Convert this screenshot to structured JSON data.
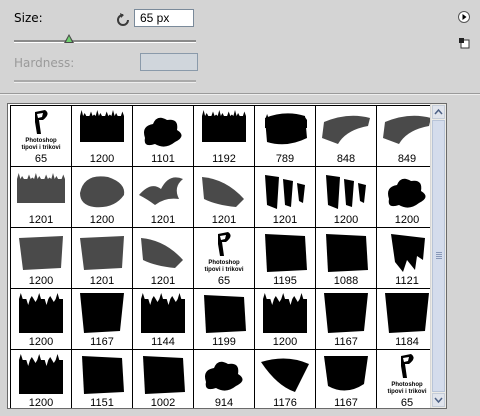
{
  "controls": {
    "size_label": "Size:",
    "size_value": "65 px",
    "size_slider_fraction": 0.3,
    "hardness_label": "Hardness:",
    "hardness_value": ""
  },
  "icons": {
    "reset": "reset-icon",
    "flyout": "flyout-menu-icon",
    "new_preset": "new-preset-icon"
  },
  "logo": {
    "line1": "Photoshop",
    "line2": "tipovi i trikovi"
  },
  "brushes": [
    {
      "n": "65",
      "kind": "logo"
    },
    {
      "n": "1200",
      "kind": "grass"
    },
    {
      "n": "1101",
      "kind": "splat"
    },
    {
      "n": "1192",
      "kind": "grass"
    },
    {
      "n": "789",
      "kind": "blob"
    },
    {
      "n": "848",
      "kind": "wedge"
    },
    {
      "n": "849",
      "kind": "wedge"
    },
    {
      "n": "1201",
      "kind": "grass-grey"
    },
    {
      "n": "1200",
      "kind": "oval-grey"
    },
    {
      "n": "1201",
      "kind": "bird-grey"
    },
    {
      "n": "1201",
      "kind": "fan-grey"
    },
    {
      "n": "1201",
      "kind": "streaks"
    },
    {
      "n": "1200",
      "kind": "streaks"
    },
    {
      "n": "1200",
      "kind": "splat"
    },
    {
      "n": "1200",
      "kind": "rect-grey"
    },
    {
      "n": "1201",
      "kind": "rect-grey"
    },
    {
      "n": "1201",
      "kind": "fan-grey"
    },
    {
      "n": "65",
      "kind": "logo"
    },
    {
      "n": "1195",
      "kind": "block"
    },
    {
      "n": "1088",
      "kind": "block"
    },
    {
      "n": "1121",
      "kind": "drip"
    },
    {
      "n": "1200",
      "kind": "spiky"
    },
    {
      "n": "1167",
      "kind": "spiky-top"
    },
    {
      "n": "1144",
      "kind": "spiky"
    },
    {
      "n": "1199",
      "kind": "block"
    },
    {
      "n": "1200",
      "kind": "spiky"
    },
    {
      "n": "1167",
      "kind": "spiky-top"
    },
    {
      "n": "1184",
      "kind": "spiky-top"
    },
    {
      "n": "1200",
      "kind": "spiky"
    },
    {
      "n": "1151",
      "kind": "block"
    },
    {
      "n": "1002",
      "kind": "block"
    },
    {
      "n": "914",
      "kind": "splat"
    },
    {
      "n": "1176",
      "kind": "fan"
    },
    {
      "n": "1167",
      "kind": "bowl"
    },
    {
      "n": "65",
      "kind": "logo"
    }
  ],
  "selected_index": 0,
  "colors": {
    "panel_bg": "#d4d4d4",
    "slider_thumb": "#6fd06f"
  }
}
